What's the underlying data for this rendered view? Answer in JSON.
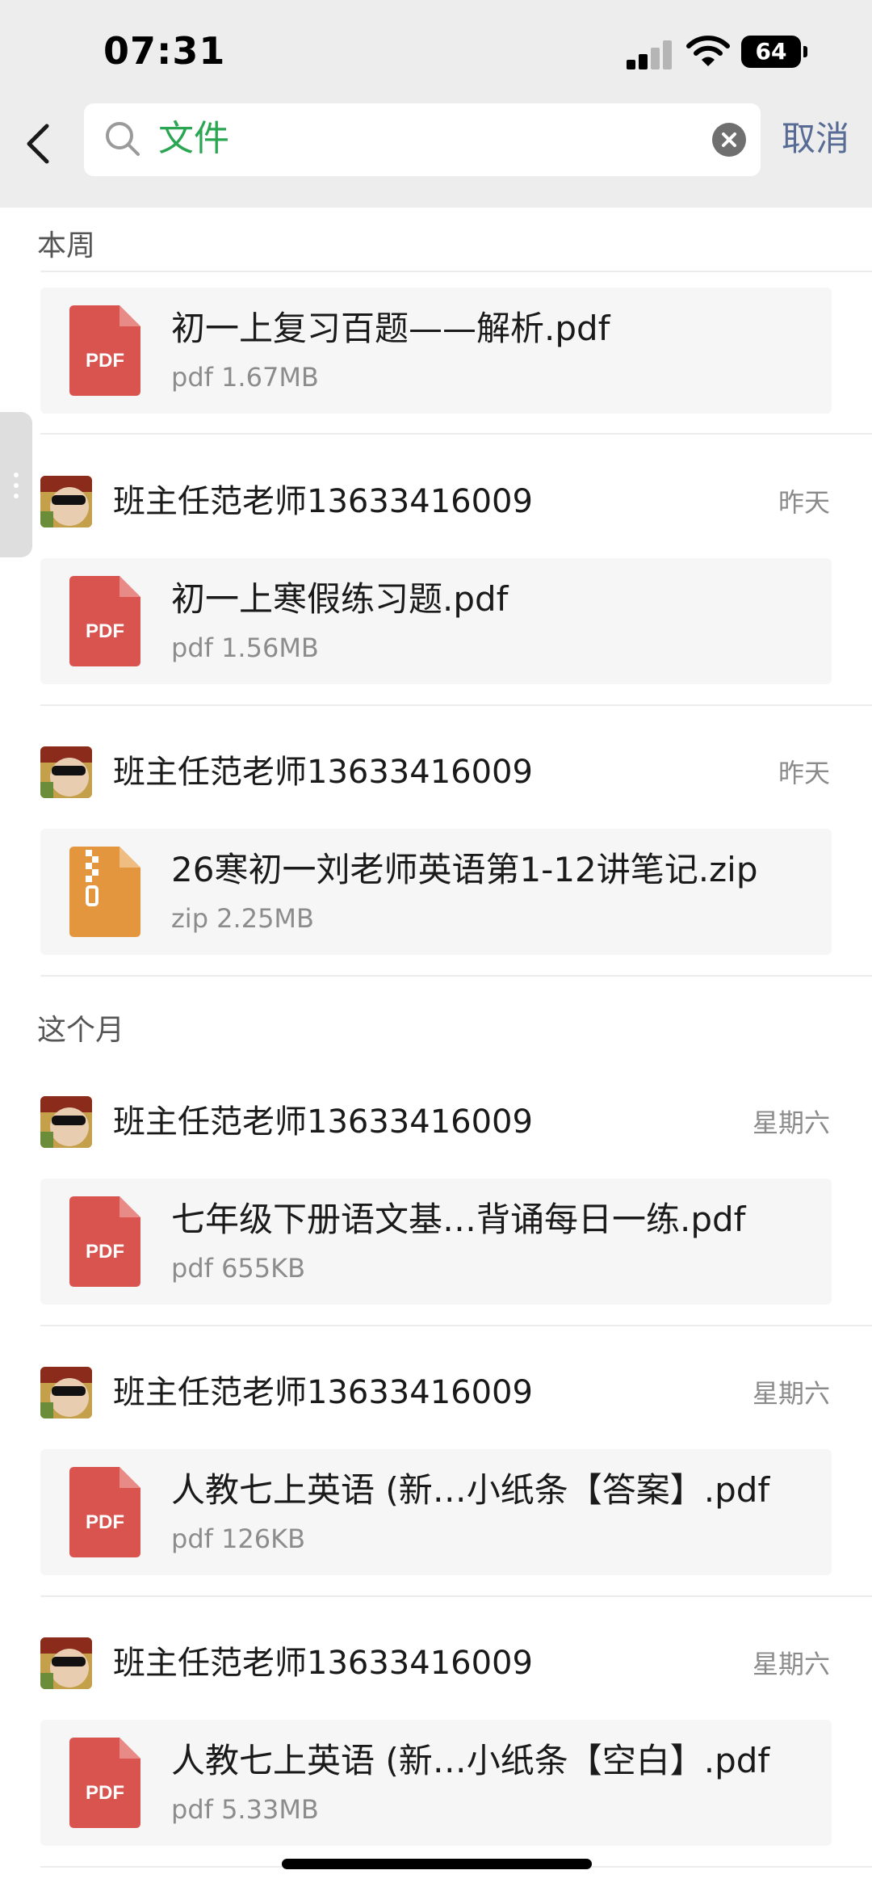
{
  "status_bar": {
    "time": "07:31",
    "battery": "64"
  },
  "search": {
    "query": "文件",
    "cancel_label": "取消"
  },
  "sections": [
    {
      "header": "本周",
      "items": [
        {
          "sender": "",
          "time": "",
          "file": {
            "name": "初一上复习百题——解析.pdf",
            "meta": "pdf 1.67MB",
            "type": "PDF"
          }
        },
        {
          "sender": "班主任范老师13633416009",
          "time": "昨天",
          "file": {
            "name": "初一上寒假练习题.pdf",
            "meta": "pdf 1.56MB",
            "type": "PDF"
          }
        },
        {
          "sender": "班主任范老师13633416009",
          "time": "昨天",
          "file": {
            "name": "26寒初一刘老师英语第1-12讲笔记.zip",
            "meta": "zip 2.25MB",
            "type": "ZIP"
          }
        }
      ]
    },
    {
      "header": "这个月",
      "items": [
        {
          "sender": "班主任范老师13633416009",
          "time": "星期六",
          "file": {
            "name": "七年级下册语文基…背诵每日一练.pdf",
            "meta": "pdf 655KB",
            "type": "PDF"
          }
        },
        {
          "sender": "班主任范老师13633416009",
          "time": "星期六",
          "file": {
            "name": "人教七上英语 (新…小纸条【答案】.pdf",
            "meta": "pdf 126KB",
            "type": "PDF"
          }
        },
        {
          "sender": "班主任范老师13633416009",
          "time": "星期六",
          "file": {
            "name": "人教七上英语 (新…小纸条【空白】.pdf",
            "meta": "pdf 5.33MB",
            "type": "PDF"
          }
        }
      ]
    }
  ],
  "colors": {
    "pdf": "#d9534f",
    "zip": "#e3963e",
    "search_text": "#2aa552",
    "cancel": "#576b95"
  },
  "icons": {
    "back": "chevron-left-icon",
    "search": "search-icon",
    "clear": "clear-icon",
    "pdf": "pdf-file-icon",
    "zip": "zip-file-icon"
  }
}
